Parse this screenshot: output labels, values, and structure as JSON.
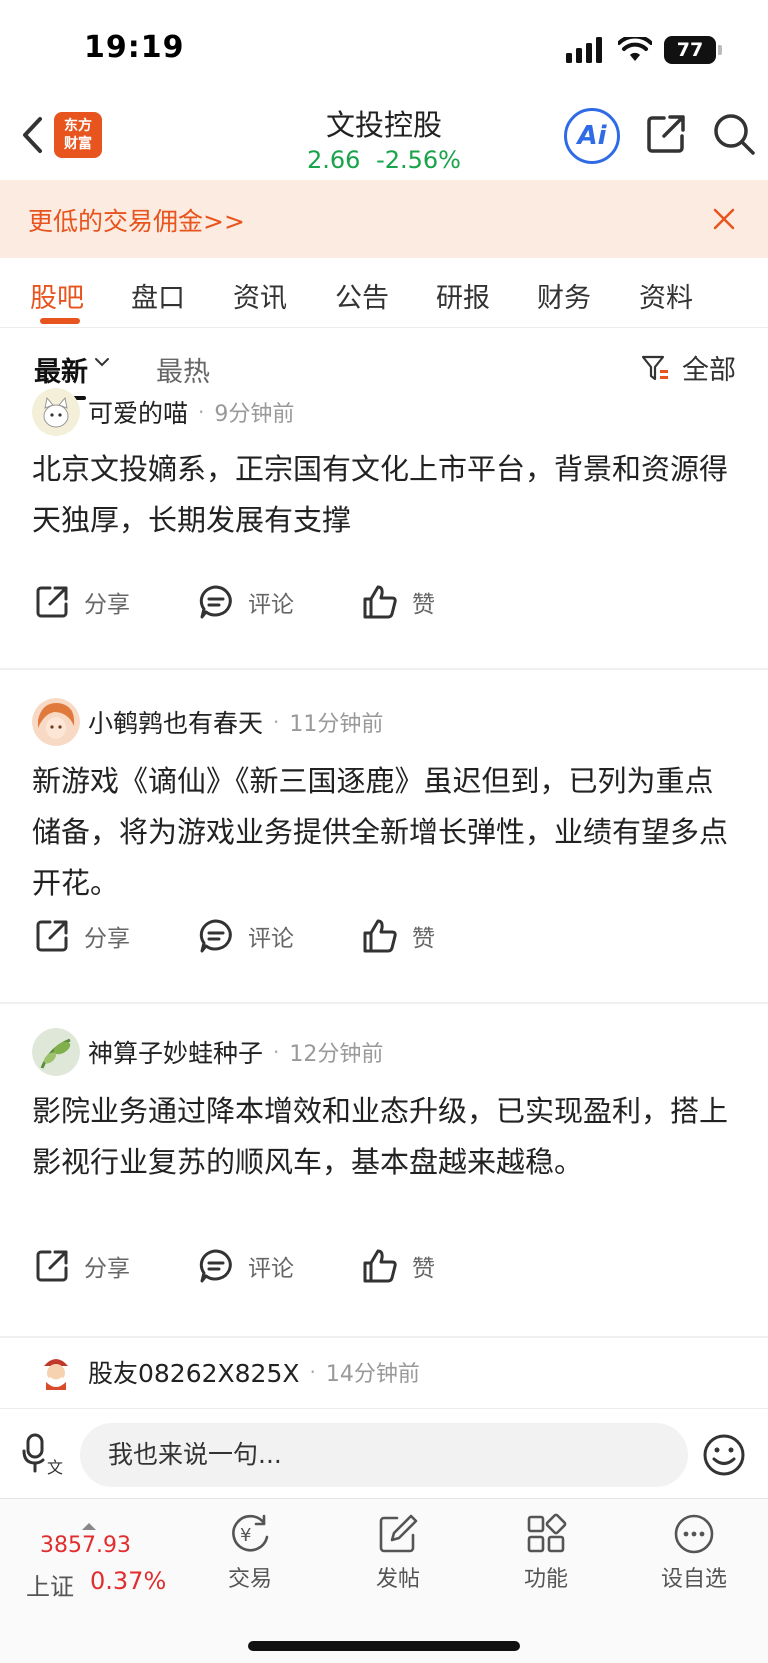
{
  "status_bar": {
    "time": "19:19",
    "battery": "77"
  },
  "header": {
    "brand_line1": "东方",
    "brand_line2": "财富",
    "stock_name": "文投控股",
    "price": "2.66",
    "change": "-2.56%",
    "ai_label": "Ai"
  },
  "promo": {
    "text": "更低的交易佣金>>"
  },
  "tabs": [
    {
      "label": "股吧"
    },
    {
      "label": "盘口"
    },
    {
      "label": "资讯"
    },
    {
      "label": "公告"
    },
    {
      "label": "研报"
    },
    {
      "label": "财务"
    },
    {
      "label": "资料"
    }
  ],
  "filter": {
    "latest": "最新",
    "hot": "最热",
    "all": "全部"
  },
  "actions": {
    "share": "分享",
    "comment": "评论",
    "like": "赞"
  },
  "posts": [
    {
      "author": "可爱的喵",
      "time": "9分钟前",
      "content": "北京文投嫡系，正宗国有文化上市平台，背景和资源得天独厚，长期发展有支撑"
    },
    {
      "author": "小鹌鹑也有春天",
      "time": "11分钟前",
      "content": "新游戏《谪仙》《新三国逐鹿》虽迟但到，已列为重点储备，将为游戏业务提供全新增长弹性，业绩有望多点开花。"
    },
    {
      "author": "神算子妙蛙种子",
      "time": "12分钟前",
      "content": "影院业务通过降本增效和业态升级，已实现盈利，搭上影视行业复苏的顺风车，基本盘越来越稳。"
    },
    {
      "author": "股友08262X825X",
      "time": "14分钟前",
      "content": ""
    }
  ],
  "comment_box": {
    "placeholder": "我也来说一句..."
  },
  "bottom_bar": {
    "index_value": "3857.93",
    "index_name": "上证",
    "index_change": "0.37%",
    "tools": [
      {
        "label": "交易",
        "icon": "trade-icon"
      },
      {
        "label": "发帖",
        "icon": "post-edit-icon"
      },
      {
        "label": "功能",
        "icon": "functions-grid-icon"
      },
      {
        "label": "设自选",
        "icon": "more-dots-icon"
      }
    ]
  },
  "colors": {
    "brand": "#e8541e",
    "quote_down": "#19a34a",
    "index_up": "#e02e2e",
    "ai_blue": "#2f6be6",
    "promo_bg": "#fcebe0"
  }
}
